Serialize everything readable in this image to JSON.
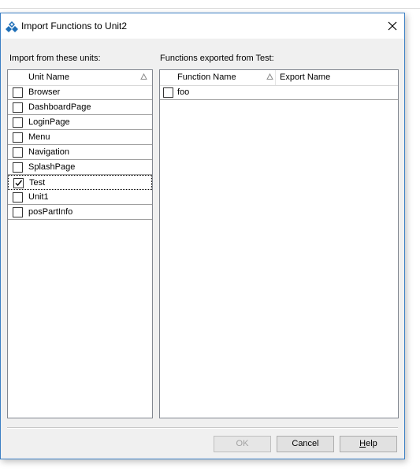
{
  "window": {
    "title": "Import Functions to Unit2",
    "app_icon": "delphi-icon",
    "close_icon": "close-icon"
  },
  "left_panel": {
    "label": "Import from these units:",
    "column_header": "Unit Name",
    "sort_icon": "sort-ascending-icon",
    "units": [
      {
        "name": "Browser",
        "checked": false
      },
      {
        "name": "DashboardPage",
        "checked": false
      },
      {
        "name": "LoginPage",
        "checked": false
      },
      {
        "name": "Menu",
        "checked": false
      },
      {
        "name": "Navigation",
        "checked": false
      },
      {
        "name": "SplashPage",
        "checked": false
      },
      {
        "name": "Test",
        "checked": true,
        "selected": true
      },
      {
        "name": "Unit1",
        "checked": false
      },
      {
        "name": "posPartInfo",
        "checked": false
      }
    ]
  },
  "right_panel": {
    "label": "Functions exported from Test:",
    "columns": [
      "Function Name",
      "Export Name"
    ],
    "sort_icon": "sort-ascending-icon",
    "functions": [
      {
        "name": "foo",
        "export_name": "",
        "checked": false
      }
    ]
  },
  "buttons": {
    "ok": "OK",
    "cancel": "Cancel",
    "help_prefix": "H",
    "help_rest": "elp"
  },
  "colors": {
    "accent_border": "#3b7fc4",
    "dialog_bg": "#f0f0f0",
    "button_bg": "#e1e1e1"
  }
}
